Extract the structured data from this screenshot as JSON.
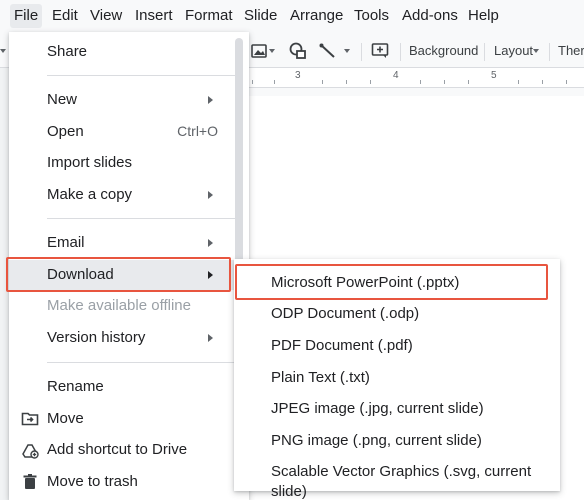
{
  "menubar": {
    "items": [
      "File",
      "Edit",
      "View",
      "Insert",
      "Format",
      "Slide",
      "Arrange",
      "Tools",
      "Add-ons",
      "Help"
    ]
  },
  "toolbar": {
    "background_label": "Background",
    "layout_label": "Layout",
    "theme_label": "Ther"
  },
  "ruler": {
    "marks": [
      "3",
      "4",
      "5"
    ]
  },
  "file_menu": {
    "share": "Share",
    "new": "New",
    "open": "Open",
    "open_shortcut": "Ctrl+O",
    "import_slides": "Import slides",
    "make_a_copy": "Make a copy",
    "email": "Email",
    "download": "Download",
    "make_available_offline": "Make available offline",
    "version_history": "Version history",
    "rename": "Rename",
    "move": "Move",
    "add_shortcut": "Add shortcut to Drive",
    "move_to_trash": "Move to trash"
  },
  "download_menu": {
    "items": [
      "Microsoft PowerPoint (.pptx)",
      "ODP Document (.odp)",
      "PDF Document (.pdf)",
      "Plain Text (.txt)",
      "JPEG image (.jpg, current slide)",
      "PNG image (.png, current slide)",
      "Scalable Vector Graphics (.svg, current slide)"
    ]
  },
  "colors": {
    "highlight": "#e8553f",
    "menu_hover": "#e8eaed"
  }
}
